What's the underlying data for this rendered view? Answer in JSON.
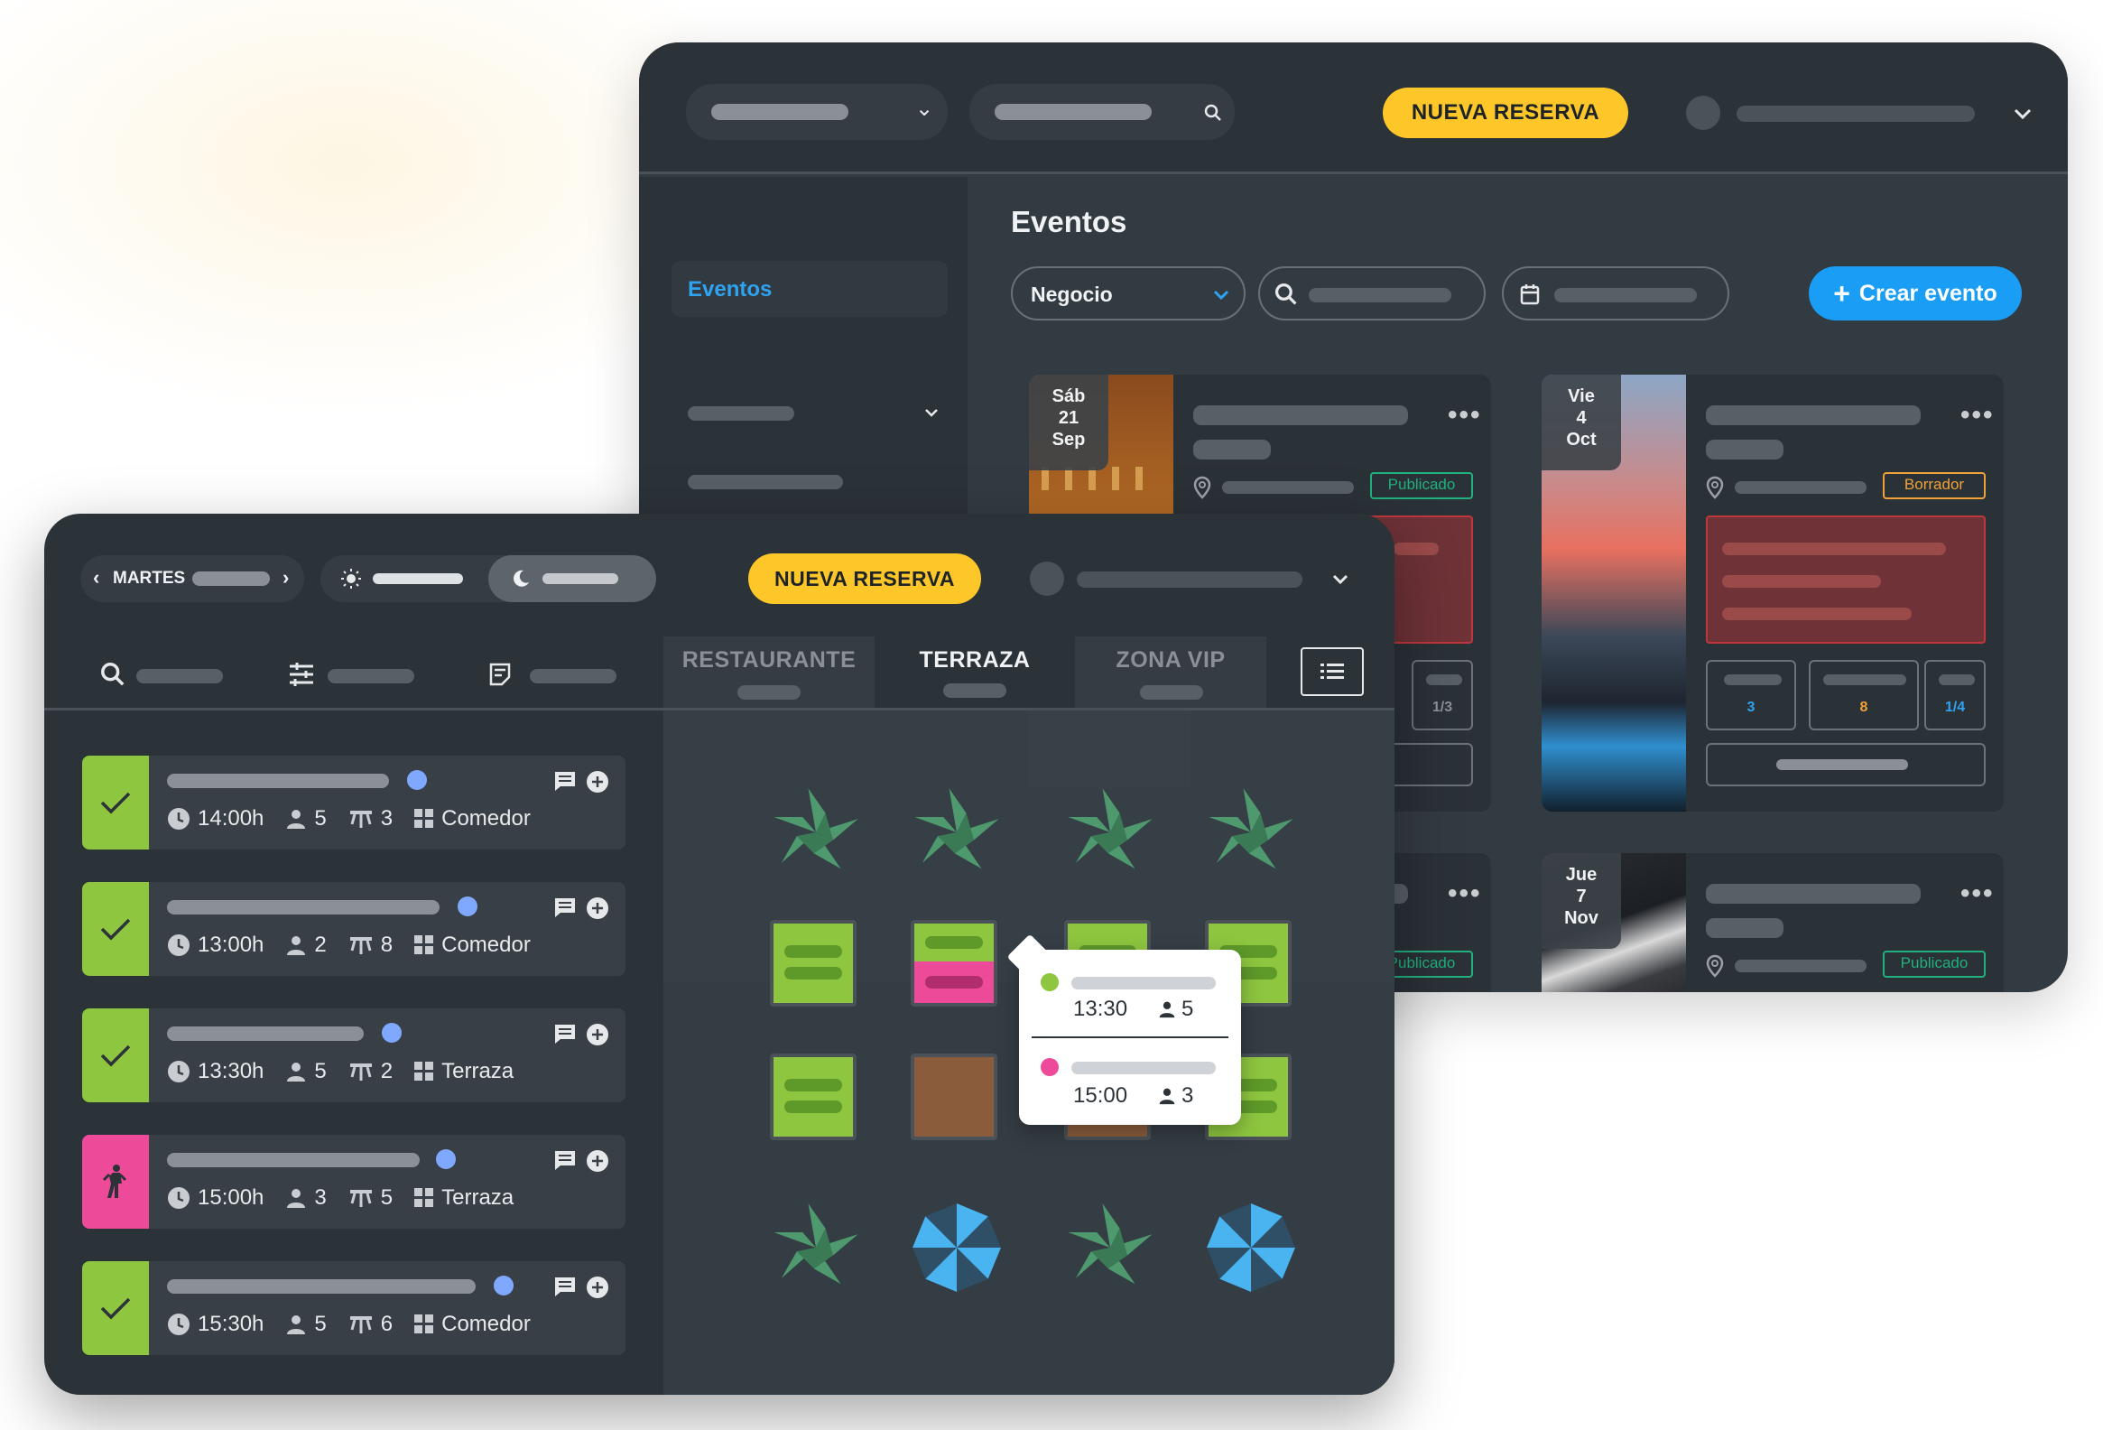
{
  "back_window": {
    "new_reservation_label": "NUEVA RESERVA",
    "sidebar_active": "Eventos",
    "page_title": "Eventos",
    "filter_business": "Negocio",
    "create_event_label": "Crear evento",
    "events": [
      {
        "day": "Sáb",
        "date": "21",
        "month": "Sep",
        "status": "Publicado",
        "status_color": "#21b07e",
        "stats": [
          "1/3"
        ]
      },
      {
        "day": "Vie",
        "date": "4",
        "month": "Oct",
        "status": "Borrador",
        "status_color": "#f0a23a",
        "stats": [
          "3",
          "8",
          "1/4"
        ]
      },
      {
        "day": "Jue",
        "date": "7",
        "month": "Nov",
        "status": "Publicado",
        "status_color": "#21b07e"
      },
      {
        "status": "Publicado",
        "status_color": "#21b07e"
      }
    ]
  },
  "front_window": {
    "day_label": "MARTES",
    "new_reservation_label": "NUEVA RESERVA",
    "tabs": [
      "RESTAURANTE",
      "TERRAZA",
      "ZONA VIP"
    ],
    "active_tab": "TERRAZA",
    "reservations": [
      {
        "status": "seated",
        "status_color": "#8ec63f",
        "time": "14:00h",
        "guests": "5",
        "table": "3",
        "zone": "Comedor"
      },
      {
        "status": "seated",
        "status_color": "#8ec63f",
        "time": "13:00h",
        "guests": "2",
        "table": "8",
        "zone": "Comedor"
      },
      {
        "status": "seated",
        "status_color": "#8ec63f",
        "time": "13:30h",
        "guests": "5",
        "table": "2",
        "zone": "Terraza"
      },
      {
        "status": "arriving",
        "status_color": "#ee4a9a",
        "time": "15:00h",
        "guests": "3",
        "table": "5",
        "zone": "Terraza"
      },
      {
        "status": "seated",
        "status_color": "#8ec63f",
        "time": "15:30h",
        "guests": "5",
        "table": "6",
        "zone": "Comedor"
      }
    ],
    "tooltip": [
      {
        "color": "#8ec63f",
        "time": "13:30",
        "guests": "5"
      },
      {
        "color": "#ee4a9a",
        "time": "15:00",
        "guests": "3"
      }
    ]
  }
}
